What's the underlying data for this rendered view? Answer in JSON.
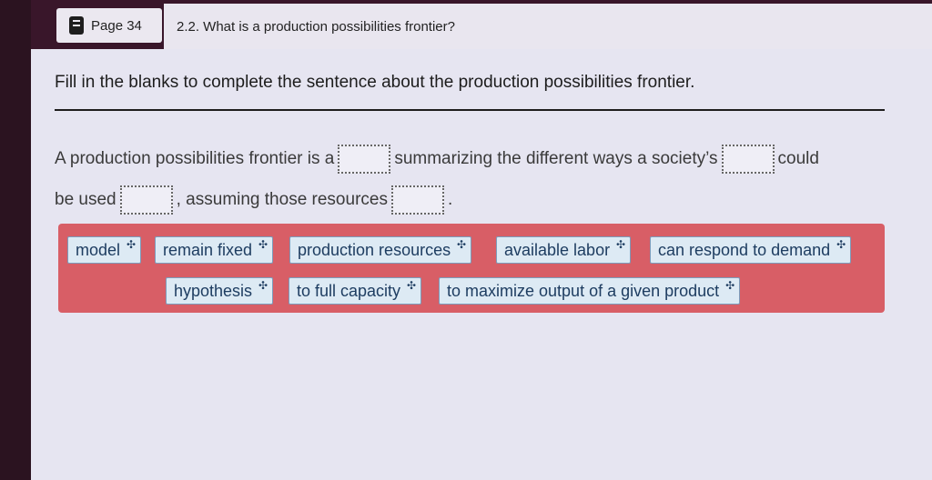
{
  "header": {
    "page_label": "Page 34",
    "section_title": "2.2. What is a production possibilities frontier?"
  },
  "question": {
    "instruction": "Fill in the blanks to complete the sentence about the production possibilities frontier.",
    "sentence_parts": [
      "A production possibilities frontier is a",
      "summarizing the different ways a society’s",
      "could",
      "be used",
      ", assuming those resources",
      "."
    ]
  },
  "word_bank": {
    "chips": [
      "model",
      "remain fixed",
      "production resources",
      "available labor",
      "can respond to demand",
      "hypothesis",
      "to full capacity",
      "to maximize output of a given product"
    ],
    "drag_icon": "move-icon"
  },
  "colors": {
    "topbar": "#39162a",
    "bank_background": "#d85e66",
    "chip_background": "#ddeaf4",
    "chip_text": "#1e3d61"
  }
}
